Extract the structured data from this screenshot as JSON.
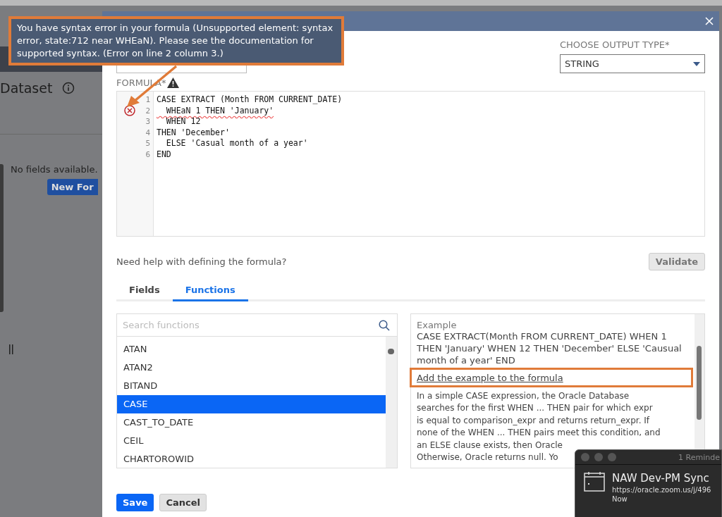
{
  "background": {
    "heading": "Dataset",
    "empty_text": "No fields available.",
    "new_button": "New For"
  },
  "tooltip": {
    "text": "You have syntax error in your formula (Unsupported element: syntax error, state:712 near WHEaN). Please see the documentation for supported syntax. (Error on line 2 column 3.)"
  },
  "dialog": {
    "output_type_label": "CHOOSE OUTPUT TYPE*",
    "output_type": "STRING",
    "formula_label": "FORMULA*",
    "code_lines": [
      {
        "number": "1",
        "text": "CASE EXTRACT (Month FROM CURRENT_DATE)",
        "error": false
      },
      {
        "number": "2",
        "text": "  WHEaN 1 THEN 'January'",
        "error": true
      },
      {
        "number": "3",
        "text": "  WHEN 12",
        "error": false
      },
      {
        "number": "4",
        "text": "THEN 'December'",
        "error": false
      },
      {
        "number": "5",
        "text": "  ELSE 'Casual month of a year'",
        "error": false
      },
      {
        "number": "6",
        "text": "END",
        "error": false
      }
    ],
    "help_text": "Need help with defining the formula?",
    "validate_button": "Validate",
    "tabs": [
      {
        "label": "Fields",
        "selected": false
      },
      {
        "label": "Functions",
        "selected": true
      }
    ],
    "search": {
      "placeholder": "Search functions"
    },
    "functions": [
      {
        "name": "ATAN",
        "selected": false
      },
      {
        "name": "ATAN2",
        "selected": false
      },
      {
        "name": "BITAND",
        "selected": false
      },
      {
        "name": "CASE",
        "selected": true
      },
      {
        "name": "CAST_TO_DATE",
        "selected": false
      },
      {
        "name": "CEIL",
        "selected": false
      },
      {
        "name": "CHARTOROWID",
        "selected": false
      }
    ],
    "example_label": "Example",
    "example_text": "CASE EXTRACT(Month FROM CURRENT_DATE) WHEN 1 THEN 'January' WHEN 12 THEN 'December' ELSE 'Causual month of a year' END",
    "add_example_link": "Add the example to the formula",
    "description_lines": [
      "In a simple CASE expression, the Oracle Database",
      "searches for the first WHEN ... THEN pair for which expr",
      "is equal to comparison_expr and returns return_expr. If",
      "none of the WHEN ... THEN pairs meet this condition, and",
      "an ELSE clause exists, then Oracle",
      "Otherwise, Oracle returns null. Yo"
    ],
    "buttons": [
      "Save",
      "Cancel"
    ]
  },
  "notification": {
    "title": "1 Reminde",
    "event": "NAW Dev-PM Sync",
    "link": "https://oracle.zoom.us/j/496",
    "time": "Now"
  }
}
